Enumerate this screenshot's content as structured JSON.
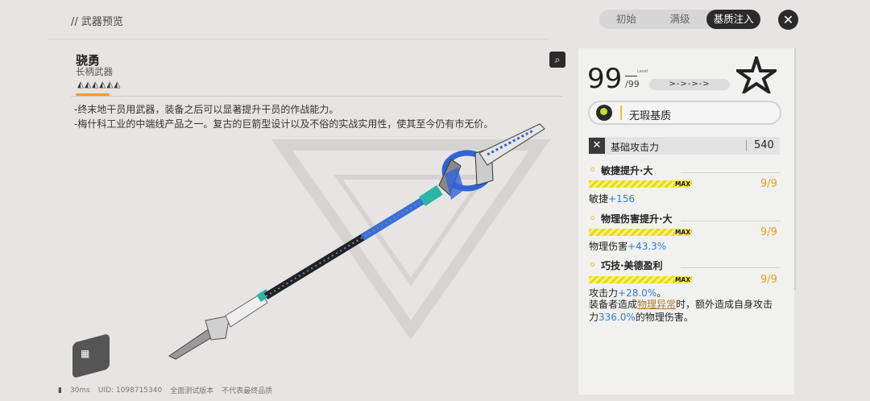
{
  "header": {
    "breadcrumb": "// 武器预览",
    "tabs": [
      {
        "label": "初始",
        "active": false
      },
      {
        "label": "满级",
        "active": false
      },
      {
        "label": "基质注入",
        "active": true
      }
    ],
    "close_icon": "close-x-icon"
  },
  "weapon": {
    "name": "骁勇",
    "type": "长柄武器",
    "rarity_stars": 6,
    "rarity_color": "#f39a2c",
    "description": [
      "-终末地干员用武器，装备之后可以显著提升干员的作战能力。",
      "-梅什科工业的中端线产品之一。复古的巨箭型设计以及不俗的实战实用性，使其至今仍有市无价。"
    ]
  },
  "level": {
    "current": "99",
    "max": "/99",
    "label": "Level"
  },
  "quality": {
    "label": "无瑕基质",
    "accent": "#f2c02b"
  },
  "base_attack": {
    "label": "基础攻击力",
    "value": "540"
  },
  "stats": [
    {
      "name": "敏捷提升·大",
      "level": "9/9",
      "max_label": "MAX",
      "fill": 1.0,
      "effect_label": "敏捷",
      "effect_value": "+156"
    },
    {
      "name": "物理伤害提升·大",
      "level": "9/9",
      "max_label": "MAX",
      "fill": 1.0,
      "effect_label": "物理伤害",
      "effect_value": "+43.3%"
    },
    {
      "name": "巧技·美德盈利",
      "level": "9/9",
      "max_label": "MAX",
      "fill": 1.0,
      "effect_label": "攻击力",
      "effect_value": "+28.0%",
      "effect_suffix": "。"
    }
  ],
  "extra_effect": {
    "prefix": "装备者造成",
    "keyword": "物理异常",
    "middle": "时，额外造成自身攻击力",
    "value": "336.0%",
    "suffix": "的物理伤害。"
  },
  "status_bar": {
    "ping": "30ms",
    "uid": "UID: 1098715340",
    "note1": "全面测试版本",
    "note2": "不代表最终品质"
  },
  "colors": {
    "accent_yellow": "#e8dc1c",
    "stat_level": "#e2a21a",
    "effect_blue": "#2f7cd8"
  }
}
